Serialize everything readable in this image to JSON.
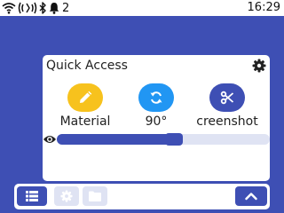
{
  "status_bar": {
    "notification_count": "2",
    "time": "16:29",
    "icons": [
      "wifi-icon",
      "signal-icon",
      "bluetooth-icon",
      "bell-icon"
    ]
  },
  "quick_access": {
    "title": "Quick Access",
    "actions": [
      {
        "label": "Material",
        "icon": "pencil-icon",
        "color": "#f7c21d"
      },
      {
        "label": "90°",
        "icon": "rotate-icon",
        "color": "#2196f3"
      },
      {
        "label": "creenshot",
        "icon": "scissors-icon",
        "color": "#3e4fb4"
      }
    ],
    "opacity_level": 0.55
  },
  "taskbar": {
    "buttons": [
      "list-icon",
      "settings-icon",
      "folder-icon",
      "chevron-up-icon"
    ]
  },
  "colors": {
    "background": "#3e4fb4",
    "accent": "#3e4fb4",
    "yellow": "#f7c21d",
    "blue": "#2196f3",
    "disabled": "#dfe3f3"
  }
}
